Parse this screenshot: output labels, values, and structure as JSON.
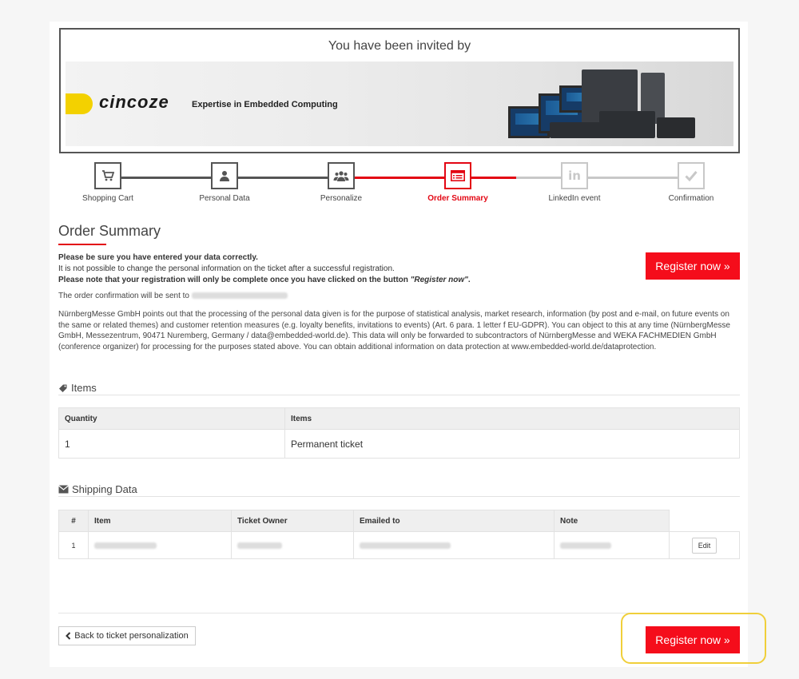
{
  "banner": {
    "title": "You have been invited by",
    "logo_text": "cincoze",
    "tagline": "Expertise in Embedded Computing"
  },
  "steps": [
    {
      "label": "Shopping Cart",
      "icon": "cart-icon"
    },
    {
      "label": "Personal Data",
      "icon": "user-icon"
    },
    {
      "label": "Personalize",
      "icon": "users-icon"
    },
    {
      "label": "Order Summary",
      "icon": "list-icon"
    },
    {
      "label": "LinkedIn event",
      "icon": "linkedin-icon"
    },
    {
      "label": "Confirmation",
      "icon": "check-icon"
    }
  ],
  "active_step": "Order Summary",
  "page_title": "Order Summary",
  "intro": {
    "line1": "Please be sure you have entered your data correctly.",
    "line2": "It is not possible to change the personal information on the ticket after a successful registration.",
    "line3_prefix": "Please note that your registration will only be complete once you have clicked on the button ",
    "line3_quote": "\"Register now\"",
    "line3_suffix": "."
  },
  "confirmation_text": "The order confirmation will be sent to",
  "privacy_text": "NürnbergMesse GmbH points out that the processing of the personal data given is for the purpose of statistical analysis, market research, information (by post and e-mail, on future events on the same or related themes) and customer retention measures (e.g. loyalty benefits, invitations to events) (Art. 6 para. 1 letter f EU-GDPR). You can object to this at any time (NürnbergMesse GmbH, Messezentrum, 90471 Nuremberg, Germany / data@embedded-world.de). This data will only be forwarded to subcontractors of NürnbergMesse and WEKA FACHMEDIEN GmbH (conference organizer) for processing for the purposes stated above. You can obtain additional information on data protection at www.embedded-world.de/dataprotection.",
  "register_label": "Register now »",
  "items_section": {
    "title": "Items",
    "headers": [
      "Quantity",
      "Items"
    ],
    "rows": [
      [
        "1",
        "Permanent ticket"
      ]
    ]
  },
  "shipping_section": {
    "title": "Shipping Data",
    "headers": [
      "#",
      "Item",
      "Ticket Owner",
      "Emailed to",
      "Note",
      ""
    ],
    "rows": [
      [
        "1"
      ]
    ],
    "edit_label": "Edit"
  },
  "back_label": "Back to ticket personalization",
  "colors": {
    "accent": "#e30613",
    "button": "#f50d1b",
    "highlight": "#f0cf3a"
  }
}
